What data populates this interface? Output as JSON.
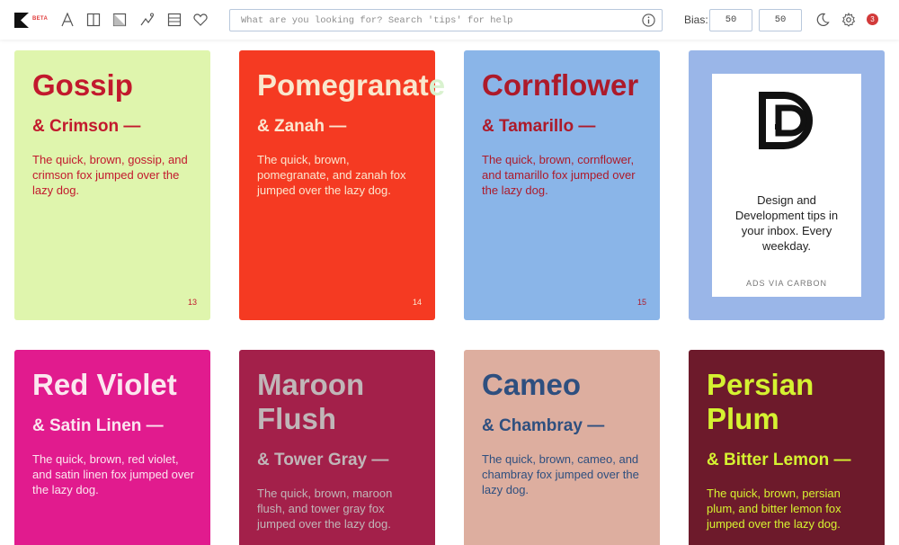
{
  "app": {
    "beta_label": "BETA"
  },
  "toolbar": {
    "tools": [
      {
        "icon": "typography-icon"
      },
      {
        "icon": "columns-icon"
      },
      {
        "icon": "image-icon"
      },
      {
        "icon": "shuffle-icon"
      },
      {
        "icon": "list-icon"
      },
      {
        "icon": "heart-icon"
      }
    ],
    "search_placeholder": "What are you looking for? Search 'tips' for help",
    "bias_label": "Bias:",
    "bias_value_1": "50",
    "bias_value_2": "50",
    "notifications_count": "3"
  },
  "cards": [
    {
      "title": "Gossip",
      "subtitle": "& Crimson —",
      "body": "The quick, brown, gossip, and crimson fox jumped over the lazy dog.",
      "number": "13"
    },
    {
      "title": "Pomegranat",
      "title_tail": "e",
      "subtitle": "& Zanah —",
      "body": "The quick, brown, pomegranate, and zanah fox jumped over the lazy dog.",
      "number": "14"
    },
    {
      "title": "Cornflower",
      "subtitle": "& Tamarillo —",
      "body": "The quick, brown, cornflower, and tamarillo fox jumped over the lazy dog.",
      "number": "15"
    },
    {
      "title": "Red Violet",
      "subtitle": "& Satin Linen —",
      "body": "The quick, brown, red violet, and satin linen fox jumped over the lazy dog."
    },
    {
      "title": "Maroon Flush",
      "subtitle": "& Tower Gray —",
      "body": "The quick, brown, maroon flush, and tower gray fox jumped over the lazy dog."
    },
    {
      "title": "Cameo",
      "subtitle": "& Chambray —",
      "body": "The quick, brown, cameo, and chambray fox jumped over the lazy dog."
    },
    {
      "title": "Persian Plum",
      "subtitle": "& Bitter Lemon —",
      "body": "The quick, brown, persian plum, and bitter lemon fox jumped over the lazy dog."
    }
  ],
  "ad": {
    "text": "Design and Development tips in your inbox. Every weekday.",
    "via": "ADS VIA CARBON"
  },
  "colors": {
    "accent": "#d23a3a",
    "border": "#b9c8dc"
  }
}
